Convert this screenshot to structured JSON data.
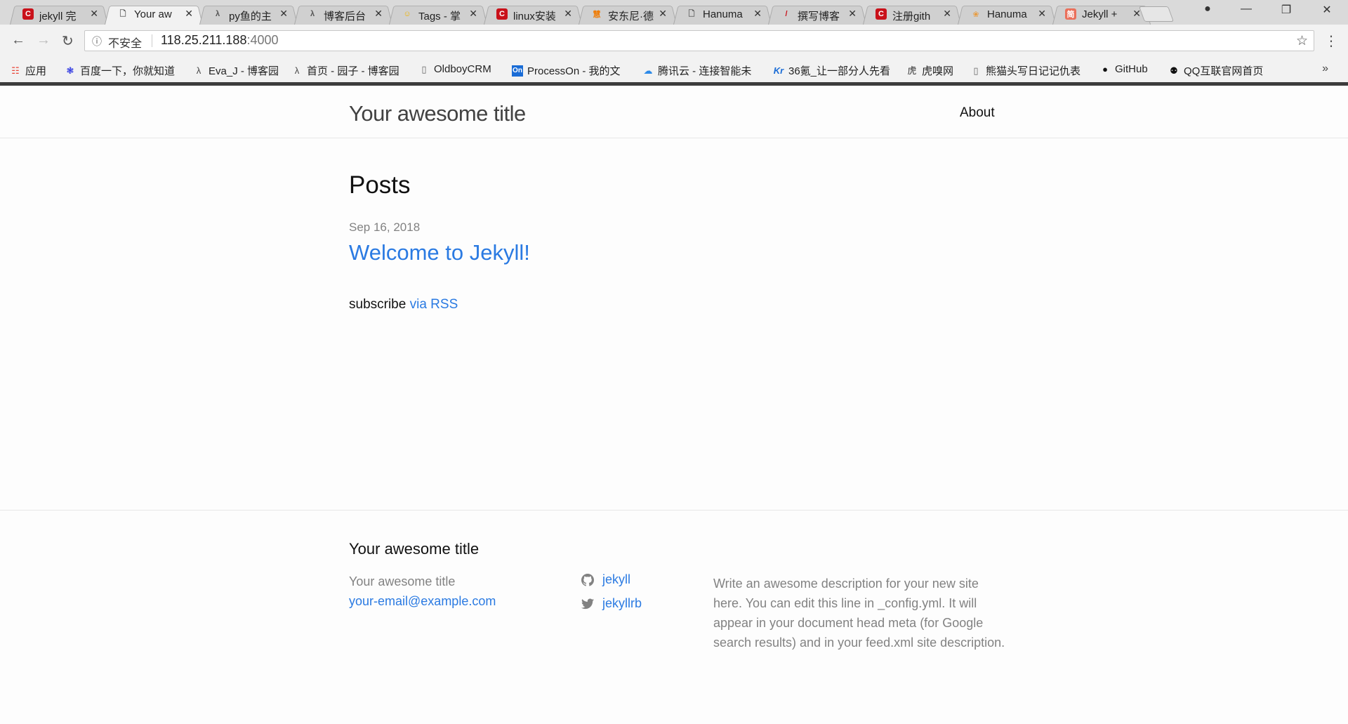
{
  "browser": {
    "tabs": [
      {
        "title": "jekyll 完",
        "favicon": "C",
        "favicon_color": "#c9111a",
        "active": false
      },
      {
        "title": "Your aw",
        "favicon": "page-icon",
        "favicon_color": "#ffffff",
        "active": true
      },
      {
        "title": "py鱼的主",
        "favicon": "cnblogs-icon",
        "favicon_color": "#dadada",
        "active": false
      },
      {
        "title": "博客后台",
        "favicon": "cnblogs-icon",
        "favicon_color": "#dadada",
        "active": false
      },
      {
        "title": "Tags - 掌",
        "favicon": "smile-icon",
        "favicon_color": "#f0b400",
        "active": false
      },
      {
        "title": "linux安装",
        "favicon": "C",
        "favicon_color": "#c9111a",
        "active": false
      },
      {
        "title": "安东尼·德",
        "favicon": "hui-icon",
        "favicon_color": "#f07a00",
        "active": false
      },
      {
        "title": "Hanuma",
        "favicon": "page-icon",
        "favicon_color": "#ffffff",
        "active": false
      },
      {
        "title": "撰写博客",
        "favicon": "pen-icon",
        "favicon_color": "#c9111a",
        "active": false
      },
      {
        "title": "注册gith",
        "favicon": "C",
        "favicon_color": "#c9111a",
        "active": false
      },
      {
        "title": "Hanuma",
        "favicon": "monkey-icon",
        "favicon_color": "#e89a3c",
        "active": false
      },
      {
        "title": "Jekyll + ",
        "favicon": "简",
        "favicon_color": "#ea6f5a",
        "active": false
      }
    ],
    "omnibox": {
      "security_label": "不安全",
      "host": "118.25.211.188",
      "port": ":4000"
    },
    "bookmarks": [
      {
        "label": "应用",
        "icon": "apps-icon"
      },
      {
        "label": "百度一下，你就知道",
        "icon": "baidu-paw-icon"
      },
      {
        "label": "Eva_J - 博客园",
        "icon": "cnblogs-icon"
      },
      {
        "label": "首页 - 园子 - 博客园",
        "icon": "cnblogs-icon"
      },
      {
        "label": "OldboyCRM",
        "icon": "page-icon"
      },
      {
        "label": "ProcessOn - 我的文",
        "icon": "processon-icon"
      },
      {
        "label": "腾讯云 - 连接智能未",
        "icon": "cloud-icon"
      },
      {
        "label": "36氪_让一部分人先看",
        "icon": "kr-icon"
      },
      {
        "label": "虎嗅网",
        "icon": "huxiu-icon"
      },
      {
        "label": "熊猫头写日记记仇表",
        "icon": "page-icon"
      },
      {
        "label": "GitHub",
        "icon": "github-icon"
      },
      {
        "label": "QQ互联官网首页",
        "icon": "qq-icon"
      }
    ]
  },
  "site": {
    "title": "Your awesome title",
    "nav": {
      "about": "About"
    }
  },
  "main": {
    "heading": "Posts",
    "posts": [
      {
        "date": "Sep 16, 2018",
        "title": "Welcome to Jekyll!"
      }
    ],
    "subscribe_prefix": "subscribe",
    "subscribe_link": "via RSS"
  },
  "footer": {
    "heading": "Your awesome title",
    "name": "Your awesome title",
    "email": "your-email@example.com",
    "github": "jekyll",
    "twitter": "jekyllrb",
    "description": "Write an awesome description for your new site here. You can edit this line in _config.yml. It will appear in your document head meta (for Google search results) and in your feed.xml site description."
  },
  "colors": {
    "link": "#2a7ae2",
    "muted": "#828282"
  }
}
